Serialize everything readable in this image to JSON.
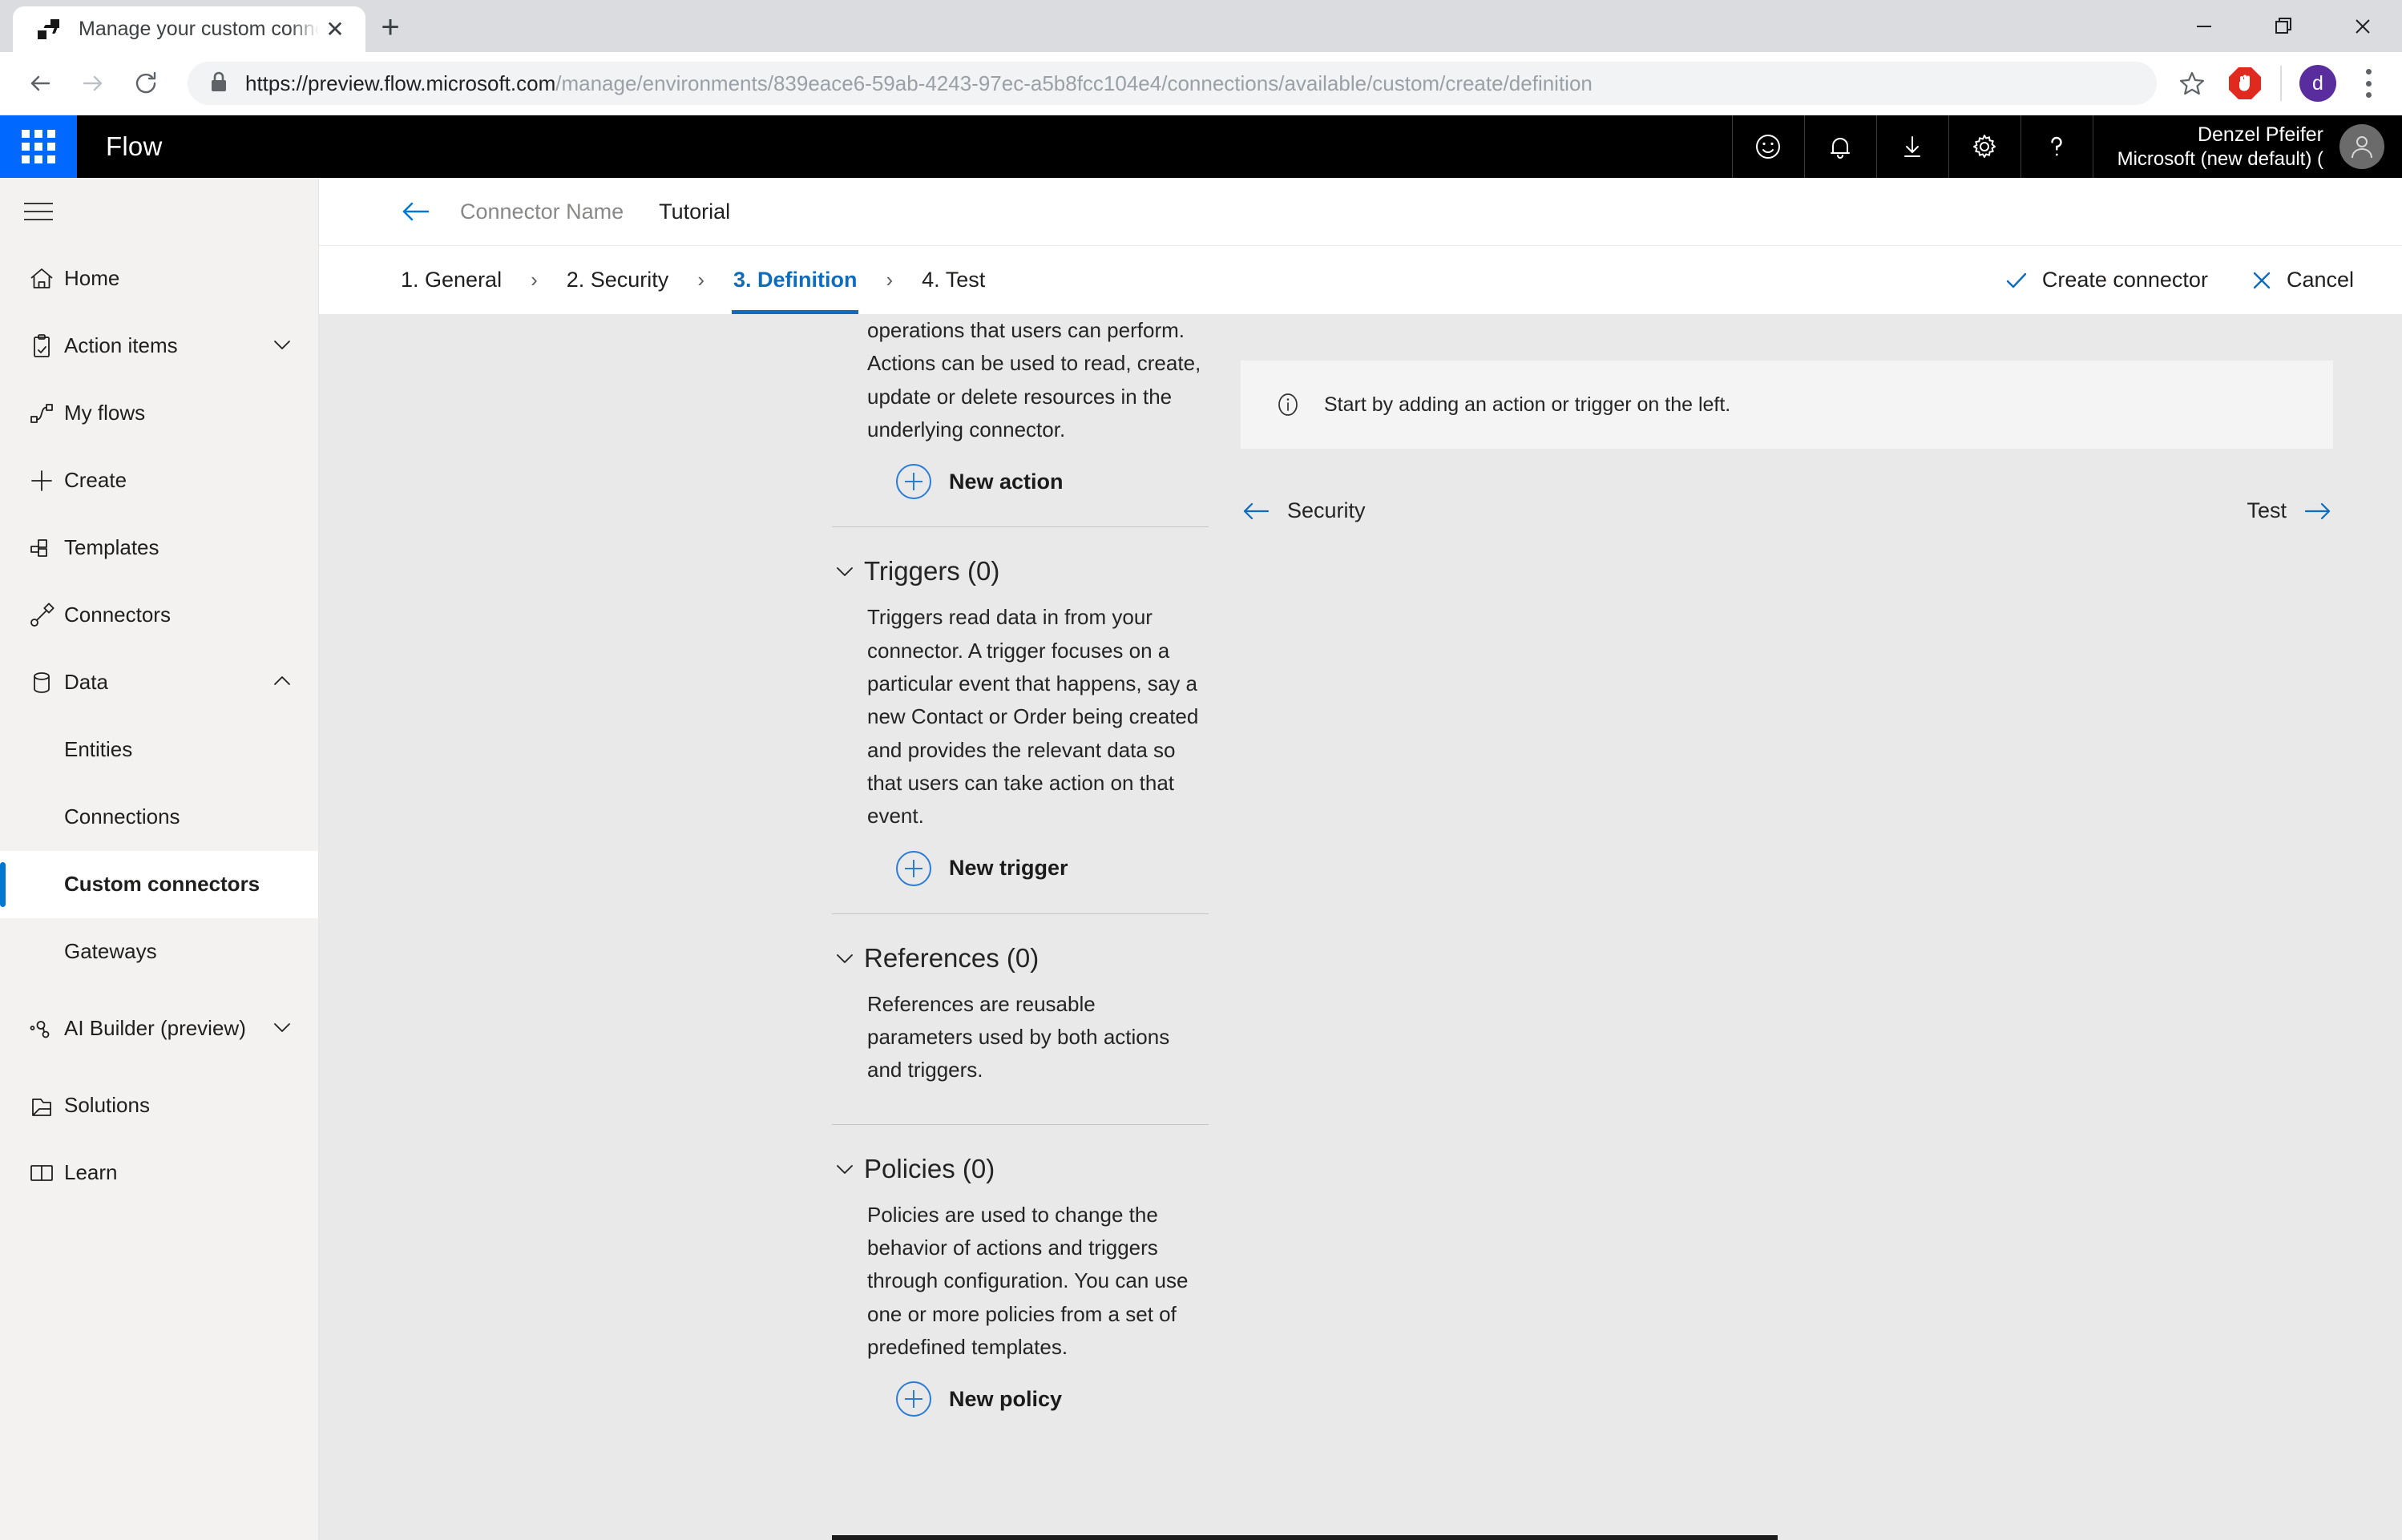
{
  "browser": {
    "tab": {
      "title": "Manage your custom connectors",
      "favicon": "flow-icon",
      "close_label": "✕"
    },
    "new_tab_label": "+",
    "window_controls": {
      "minimize": "minimize-icon",
      "maximize": "maximize-icon",
      "close": "close-icon"
    },
    "nav": {
      "back": "back-arrow-icon",
      "forward": "forward-arrow-icon",
      "reload": "reload-icon"
    },
    "omnibox": {
      "lock": "lock-icon",
      "scheme_host": "https://preview.flow.microsoft.com",
      "path": "/manage/environments/839eace6-59ab-4243-97ec-a5b8fcc104e4/connections/available/custom/create/definition"
    },
    "star": "bookmark-star-icon",
    "extension": "adblock-icon",
    "profile_initial": "d",
    "menu": "kebab-menu-icon"
  },
  "appbar": {
    "waffle": "app-launcher-icon",
    "title": "Flow",
    "icons": [
      "smiley-feedback-icon",
      "bell-notifications-icon",
      "download-icon",
      "gear-settings-icon",
      "help-question-icon"
    ],
    "user_name": "Denzel Pfeifer",
    "user_org": "Microsoft (new default) (",
    "avatar": "user-avatar-icon"
  },
  "sidebar": {
    "hamburger": "hamburger-menu-icon",
    "items": [
      {
        "label": "Home",
        "icon": "home-icon",
        "chevron": null,
        "level": "top",
        "selected": false
      },
      {
        "label": "Action items",
        "icon": "clipboard-check-icon",
        "chevron": "chevron-down-icon",
        "level": "top",
        "selected": false
      },
      {
        "label": "My flows",
        "icon": "flow-icon",
        "chevron": null,
        "level": "top",
        "selected": false
      },
      {
        "label": "Create",
        "icon": "plus-icon",
        "chevron": null,
        "level": "top",
        "selected": false
      },
      {
        "label": "Templates",
        "icon": "templates-icon",
        "chevron": null,
        "level": "top",
        "selected": false
      },
      {
        "label": "Connectors",
        "icon": "connectors-plug-icon",
        "chevron": null,
        "level": "top",
        "selected": false
      },
      {
        "label": "Data",
        "icon": "database-icon",
        "chevron": "chevron-up-icon",
        "level": "top",
        "selected": false
      },
      {
        "label": "Entities",
        "icon": null,
        "chevron": null,
        "level": "sub",
        "selected": false
      },
      {
        "label": "Connections",
        "icon": null,
        "chevron": null,
        "level": "sub",
        "selected": false
      },
      {
        "label": "Custom connectors",
        "icon": null,
        "chevron": null,
        "level": "sub",
        "selected": true
      },
      {
        "label": "Gateways",
        "icon": null,
        "chevron": null,
        "level": "sub",
        "selected": false
      },
      {
        "label": "AI Builder (preview)",
        "icon": "ai-builder-icon",
        "chevron": "chevron-down-icon",
        "level": "top-tall",
        "selected": false
      },
      {
        "label": "Solutions",
        "icon": "solutions-icon",
        "chevron": null,
        "level": "top",
        "selected": false
      },
      {
        "label": "Learn",
        "icon": "book-learn-icon",
        "chevron": null,
        "level": "top",
        "selected": false
      }
    ]
  },
  "page": {
    "back_icon": "back-arrow-icon",
    "breadcrumb_placeholder": "Connector Name",
    "breadcrumb_current": "Tutorial",
    "steps": [
      {
        "label": "1. General",
        "active": false
      },
      {
        "label": "2. Security",
        "active": false
      },
      {
        "label": "3. Definition",
        "active": true
      },
      {
        "label": "4. Test",
        "active": false
      }
    ],
    "step_separator": "›",
    "actions": [
      {
        "label": "Create connector",
        "icon": "checkmark-icon"
      },
      {
        "label": "Cancel",
        "icon": "close-x-icon"
      }
    ],
    "accent_color": "#0f6cbd",
    "link_color": "#2b7cd3"
  },
  "definition": {
    "actions_desc": "operations that users can perform. Actions can be used to read, create, update or delete resources in the underlying connector.",
    "new_action_label": "New action",
    "triggers_title": "Triggers (0)",
    "triggers_desc": "Triggers read data in from your connector. A trigger focuses on a particular event that happens, say a new Contact or Order being created and provides the relevant data so that users can take action on that event.",
    "new_trigger_label": "New trigger",
    "references_title": "References (0)",
    "references_desc": "References are reusable parameters used by both actions and triggers.",
    "policies_title": "Policies (0)",
    "policies_desc": "Policies are used to change the behavior of actions and triggers through configuration. You can use one or more policies from a set of predefined templates.",
    "new_policy_label": "New policy",
    "chevron_icon": "chevron-down-icon"
  },
  "notice": {
    "icon": "info-circle-icon",
    "text": "Start by adding an action or trigger on the left."
  },
  "pager": {
    "prev_label": "Security",
    "prev_icon": "arrow-left-icon",
    "next_label": "Test",
    "next_icon": "arrow-right-icon"
  }
}
